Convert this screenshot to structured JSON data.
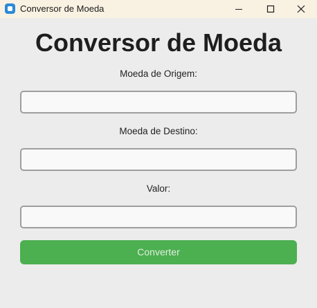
{
  "window": {
    "title": "Conversor de Moeda",
    "app_icon": "app-window-icon",
    "controls": {
      "minimize_icon": "minimize-icon",
      "maximize_icon": "maximize-icon",
      "close_icon": "close-icon"
    }
  },
  "main": {
    "heading": "Conversor de Moeda",
    "fields": [
      {
        "label": "Moeda de Origem:",
        "value": "",
        "placeholder": ""
      },
      {
        "label": "Moeda de Destino:",
        "value": "",
        "placeholder": ""
      },
      {
        "label": "Valor:",
        "value": "",
        "placeholder": ""
      }
    ],
    "convert_label": "Converter"
  },
  "colors": {
    "window_background": "#ececec",
    "titlebar_background": "#f9f2e3",
    "button_background": "#4caf50",
    "button_text": "#dff0df",
    "field_border": "#9e9e9e",
    "app_icon": "#2b8ad8"
  }
}
